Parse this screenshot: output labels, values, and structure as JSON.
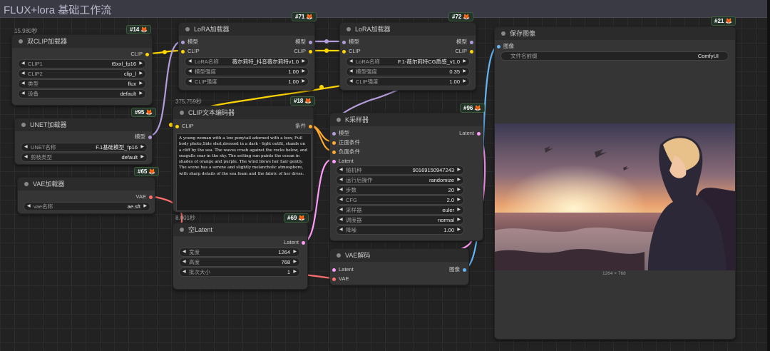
{
  "group": {
    "title": "FLUX+lora 基础工作流"
  },
  "timers": {
    "dualclip": "15.980秒",
    "clipenc": "375.759秒",
    "latent": "8.001秒"
  },
  "colors": {
    "clip_wire": "#ffd500",
    "model_wire": "#b39ddb",
    "vae_wire": "#ff6e6e",
    "latent_wire": "#ff9cf9",
    "image_wire": "#64b5f6",
    "cond_wire": "#ffa931"
  },
  "nodes": {
    "dualclip": {
      "id": "#14",
      "title": "双CLIP加载器",
      "out_clip": "CLIP",
      "widgets": [
        {
          "label": "CLIP1",
          "value": "t5xxl_fp16"
        },
        {
          "label": "CLIP2",
          "value": "clip_l"
        },
        {
          "label": "类型",
          "value": "flux"
        },
        {
          "label": "设备",
          "value": "default"
        }
      ]
    },
    "unet": {
      "id": "#95",
      "title": "UNET加载器",
      "out_model": "模型",
      "widgets": [
        {
          "label": "UNET名称",
          "value": "F.1基础模型_fp16"
        },
        {
          "label": "剪枝类型",
          "value": "default"
        }
      ]
    },
    "vaeload": {
      "id": "#65",
      "title": "VAE加载器",
      "out_vae": "VAE",
      "widgets": [
        {
          "label": "vae名称",
          "value": "ae.sft"
        }
      ]
    },
    "lora1": {
      "id": "#71",
      "title": "LoRA加载器",
      "in_model": "模型",
      "in_clip": "CLIP",
      "out_model": "模型",
      "out_clip": "CLIP",
      "widgets": [
        {
          "label": "LoRA名称",
          "value": "薇尔莉特_抖音薇尔莉特v1.0"
        },
        {
          "label": "模型强度",
          "value": "1.00"
        },
        {
          "label": "CLIP强度",
          "value": "1.00"
        }
      ]
    },
    "lora2": {
      "id": "#72",
      "title": "LoRA加载器",
      "in_model": "模型",
      "in_clip": "CLIP",
      "out_model": "模型",
      "out_clip": "CLIP",
      "widgets": [
        {
          "label": "LoRA名称",
          "value": "F.1-薇尔莉特CG质感_v1.0"
        },
        {
          "label": "模型强度",
          "value": "0.35"
        },
        {
          "label": "CLIP强度",
          "value": "1.00"
        }
      ]
    },
    "clipenc": {
      "id": "#18",
      "title": "CLIP文本编码器",
      "in_clip": "CLIP",
      "out_cond": "条件",
      "text": "A young woman with a low ponytail adorned with a bow, Full body photo,Side shot,dressed in a dark - light outfit, stands on a cliff by the sea. The waves crash against the rocks below, and seagulls soar in the sky. The setting sun paints the ocean in shades of orange and purple. The wind blows her hair gently. The scene has a serene and slightly melancholic atmosphere, with sharp details of the sea foam and the fabric of her dress."
    },
    "latent": {
      "id": "#69",
      "title": "空Latent",
      "out_latent": "Latent",
      "widgets": [
        {
          "label": "宽度",
          "value": "1264"
        },
        {
          "label": "高度",
          "value": "768"
        },
        {
          "label": "批次大小",
          "value": "1"
        }
      ]
    },
    "ksampler": {
      "id": "#96",
      "title": "K采样器",
      "in_model": "模型",
      "in_pos": "正面条件",
      "in_neg": "负面条件",
      "in_latent": "Latent",
      "out_latent": "Latent",
      "widgets": [
        {
          "label": "随机种",
          "value": "90169150947243"
        },
        {
          "label": "运行后操作",
          "value": "randomize"
        },
        {
          "label": "步数",
          "value": "20"
        },
        {
          "label": "CFG",
          "value": "2.0"
        },
        {
          "label": "采样器",
          "value": "euler"
        },
        {
          "label": "调度器",
          "value": "normal"
        },
        {
          "label": "降噪",
          "value": "1.00"
        }
      ]
    },
    "vaedecode": {
      "id": "#26",
      "title": "VAE解码",
      "in_latent": "Latent",
      "in_vae": "VAE",
      "out_image": "图像"
    },
    "save": {
      "id": "#21",
      "title": "保存图像",
      "in_image": "图像",
      "widgets": [
        {
          "label": "文件名前缀",
          "value": "ComfyUI"
        }
      ],
      "image_size": "1264 × 768"
    }
  }
}
